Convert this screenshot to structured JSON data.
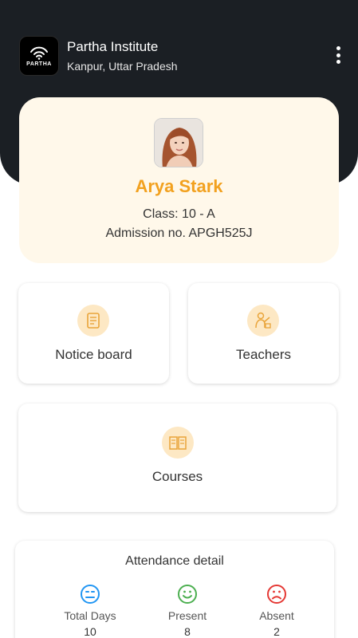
{
  "header": {
    "logo_text": "PARTHA",
    "institute_name": "Partha Institute",
    "location": "Kanpur, Uttar Pradesh"
  },
  "profile": {
    "name": "Arya Stark",
    "class_line": "Class: 10 - A",
    "admission_line": "Admission no. APGH525J"
  },
  "tiles": {
    "notice_board": "Notice board",
    "teachers": "Teachers",
    "courses": "Courses"
  },
  "attendance": {
    "title": "Attendance detail",
    "total_days": {
      "label": "Total Days",
      "value": "10",
      "color": "#2196f3"
    },
    "present": {
      "label": "Present",
      "value": "8",
      "color": "#4caf50"
    },
    "absent": {
      "label": "Absent",
      "value": "2",
      "color": "#e53935"
    }
  },
  "colors": {
    "header_bg": "#1b1f24",
    "accent": "#f2a11f",
    "profile_card_bg": "#fff8ea",
    "icon_circle_bg": "#fde8c4"
  }
}
